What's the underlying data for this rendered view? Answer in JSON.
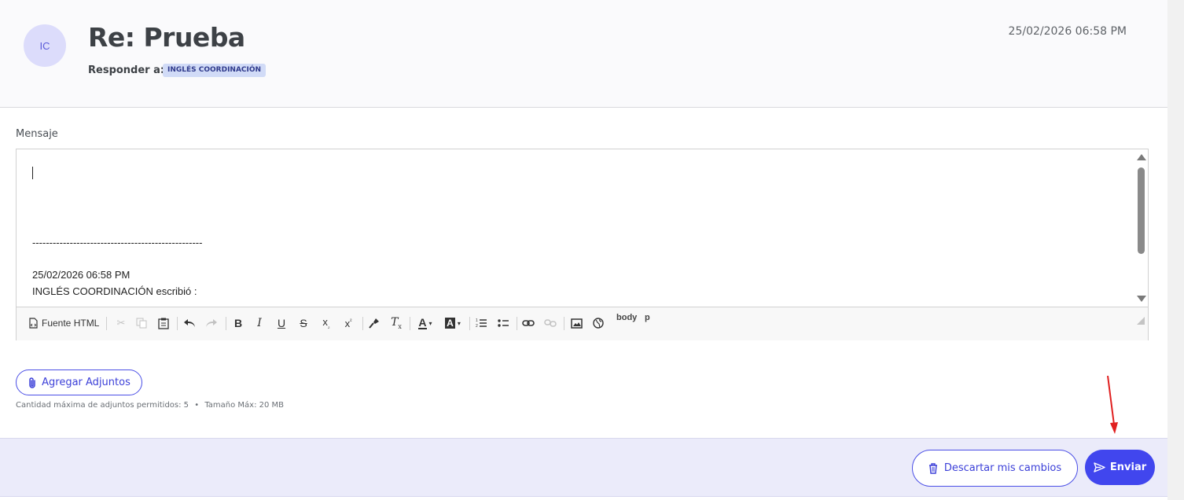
{
  "header": {
    "avatar_initials": "IC",
    "subject": "Re: Prueba",
    "reply_to_label": "Responder a:",
    "reply_to_chip": "INGLÉS COORDINACIÓN",
    "date": "25/02/2026 06:58 PM"
  },
  "editor": {
    "label": "Mensaje",
    "separator_line": "--------------------------------------------------",
    "quote_date": "25/02/2026 06:58 PM",
    "quote_author": "INGLÉS COORDINACIÓN escribió :",
    "toolbar": {
      "source_label": "Fuente HTML",
      "path_body": "body",
      "path_p": "p",
      "icons": [
        "source-html-icon",
        "cut-icon",
        "copy-icon",
        "paste-icon",
        "undo-icon",
        "redo-icon",
        "bold-icon",
        "italic-icon",
        "underline-icon",
        "strikethrough-icon",
        "subscript-icon",
        "superscript-icon",
        "copy-format-icon",
        "remove-format-icon",
        "text-color-icon",
        "background-color-icon",
        "numbered-list-icon",
        "bulleted-list-icon",
        "link-icon",
        "unlink-icon",
        "image-icon",
        "iframe-icon"
      ]
    }
  },
  "attachments": {
    "button_label": "Agregar Adjuntos",
    "max_count_text": "Cantidad máxima de adjuntos permitidos: 5",
    "bullet": "•",
    "max_size_text": "Tamaño Máx: 20 MB"
  },
  "footer": {
    "discard_label": "Descartar mis cambios",
    "send_label": "Enviar"
  },
  "colors": {
    "accent": "#4146ee",
    "footer_bg": "#ebebfa",
    "chip_bg": "#d1dbf7",
    "avatar_bg": "#dcdcfb",
    "annotation_arrow": "#e02020"
  }
}
